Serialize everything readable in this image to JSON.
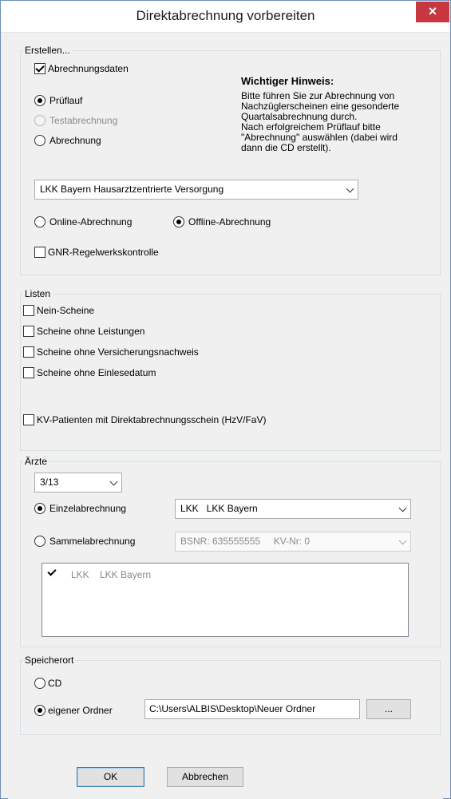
{
  "window": {
    "title": "Direktabrechnung vorbereiten",
    "close_glyph": "×"
  },
  "erstellen": {
    "legend": "Erstellen...",
    "abrechnungsdaten_label": "Abrechnungsdaten",
    "abrechnungsdaten_checked": true,
    "radio_prueflauf": "Prüflauf",
    "radio_testabrechnung": "Testabrechnung",
    "radio_abrechnung": "Abrechnung",
    "selected_mode": "Prüflauf",
    "note_title": "Wichtiger Hinweis:",
    "note_lines": [
      "Bitte führen Sie zur Abrechnung von",
      "Nachzüglerscheinen eine gesonderte",
      "Quartalsabrechnung durch.",
      "Nach erfolgreichem Prüflauf bitte",
      "\"Abrechnung\" auswählen (dabei wird",
      "dann die CD erstellt)."
    ],
    "kasse_select": "LKK Bayern Hausarztzentrierte Versorgung",
    "radio_online": "Online-Abrechnung",
    "radio_offline": "Offline-Abrechnung",
    "selected_transfer": "Offline-Abrechnung",
    "gnr_label": "GNR-Regelwerkskontrolle",
    "gnr_checked": false
  },
  "listen": {
    "legend": "Listen",
    "items": [
      {
        "label": "Nein-Scheine",
        "checked": false
      },
      {
        "label": "Scheine ohne Leistungen",
        "checked": false
      },
      {
        "label": "Scheine ohne Versicherungsnachweis",
        "checked": false
      },
      {
        "label": "Scheine ohne Einlesedatum",
        "checked": false
      }
    ],
    "kv_label": "KV-Patienten mit Direktabrechnungsschein (HzV/FaV)",
    "kv_checked": false
  },
  "aerzte": {
    "legend": "Ärzte",
    "quarter_select": "3/13",
    "radio_einzel": "Einzelabrechnung",
    "radio_sammel": "Sammelabrechnung",
    "selected": "Einzelabrechnung",
    "einzel_select": "LKK   LKK Bayern",
    "sammel_select": "BSNR: 635555555     KV-Nr: 0",
    "list_item_checked": true,
    "list_item_code": "LKK",
    "list_item_name": "LKK Bayern"
  },
  "speicherort": {
    "legend": "Speicherort",
    "radio_cd": "CD",
    "radio_ordner": "eigener Ordner",
    "selected": "eigener Ordner",
    "path_value": "C:\\Users\\ALBIS\\Desktop\\Neuer Ordner",
    "browse_label": "..."
  },
  "buttons": {
    "ok_label": "OK",
    "cancel_label": "Abbrechen"
  }
}
